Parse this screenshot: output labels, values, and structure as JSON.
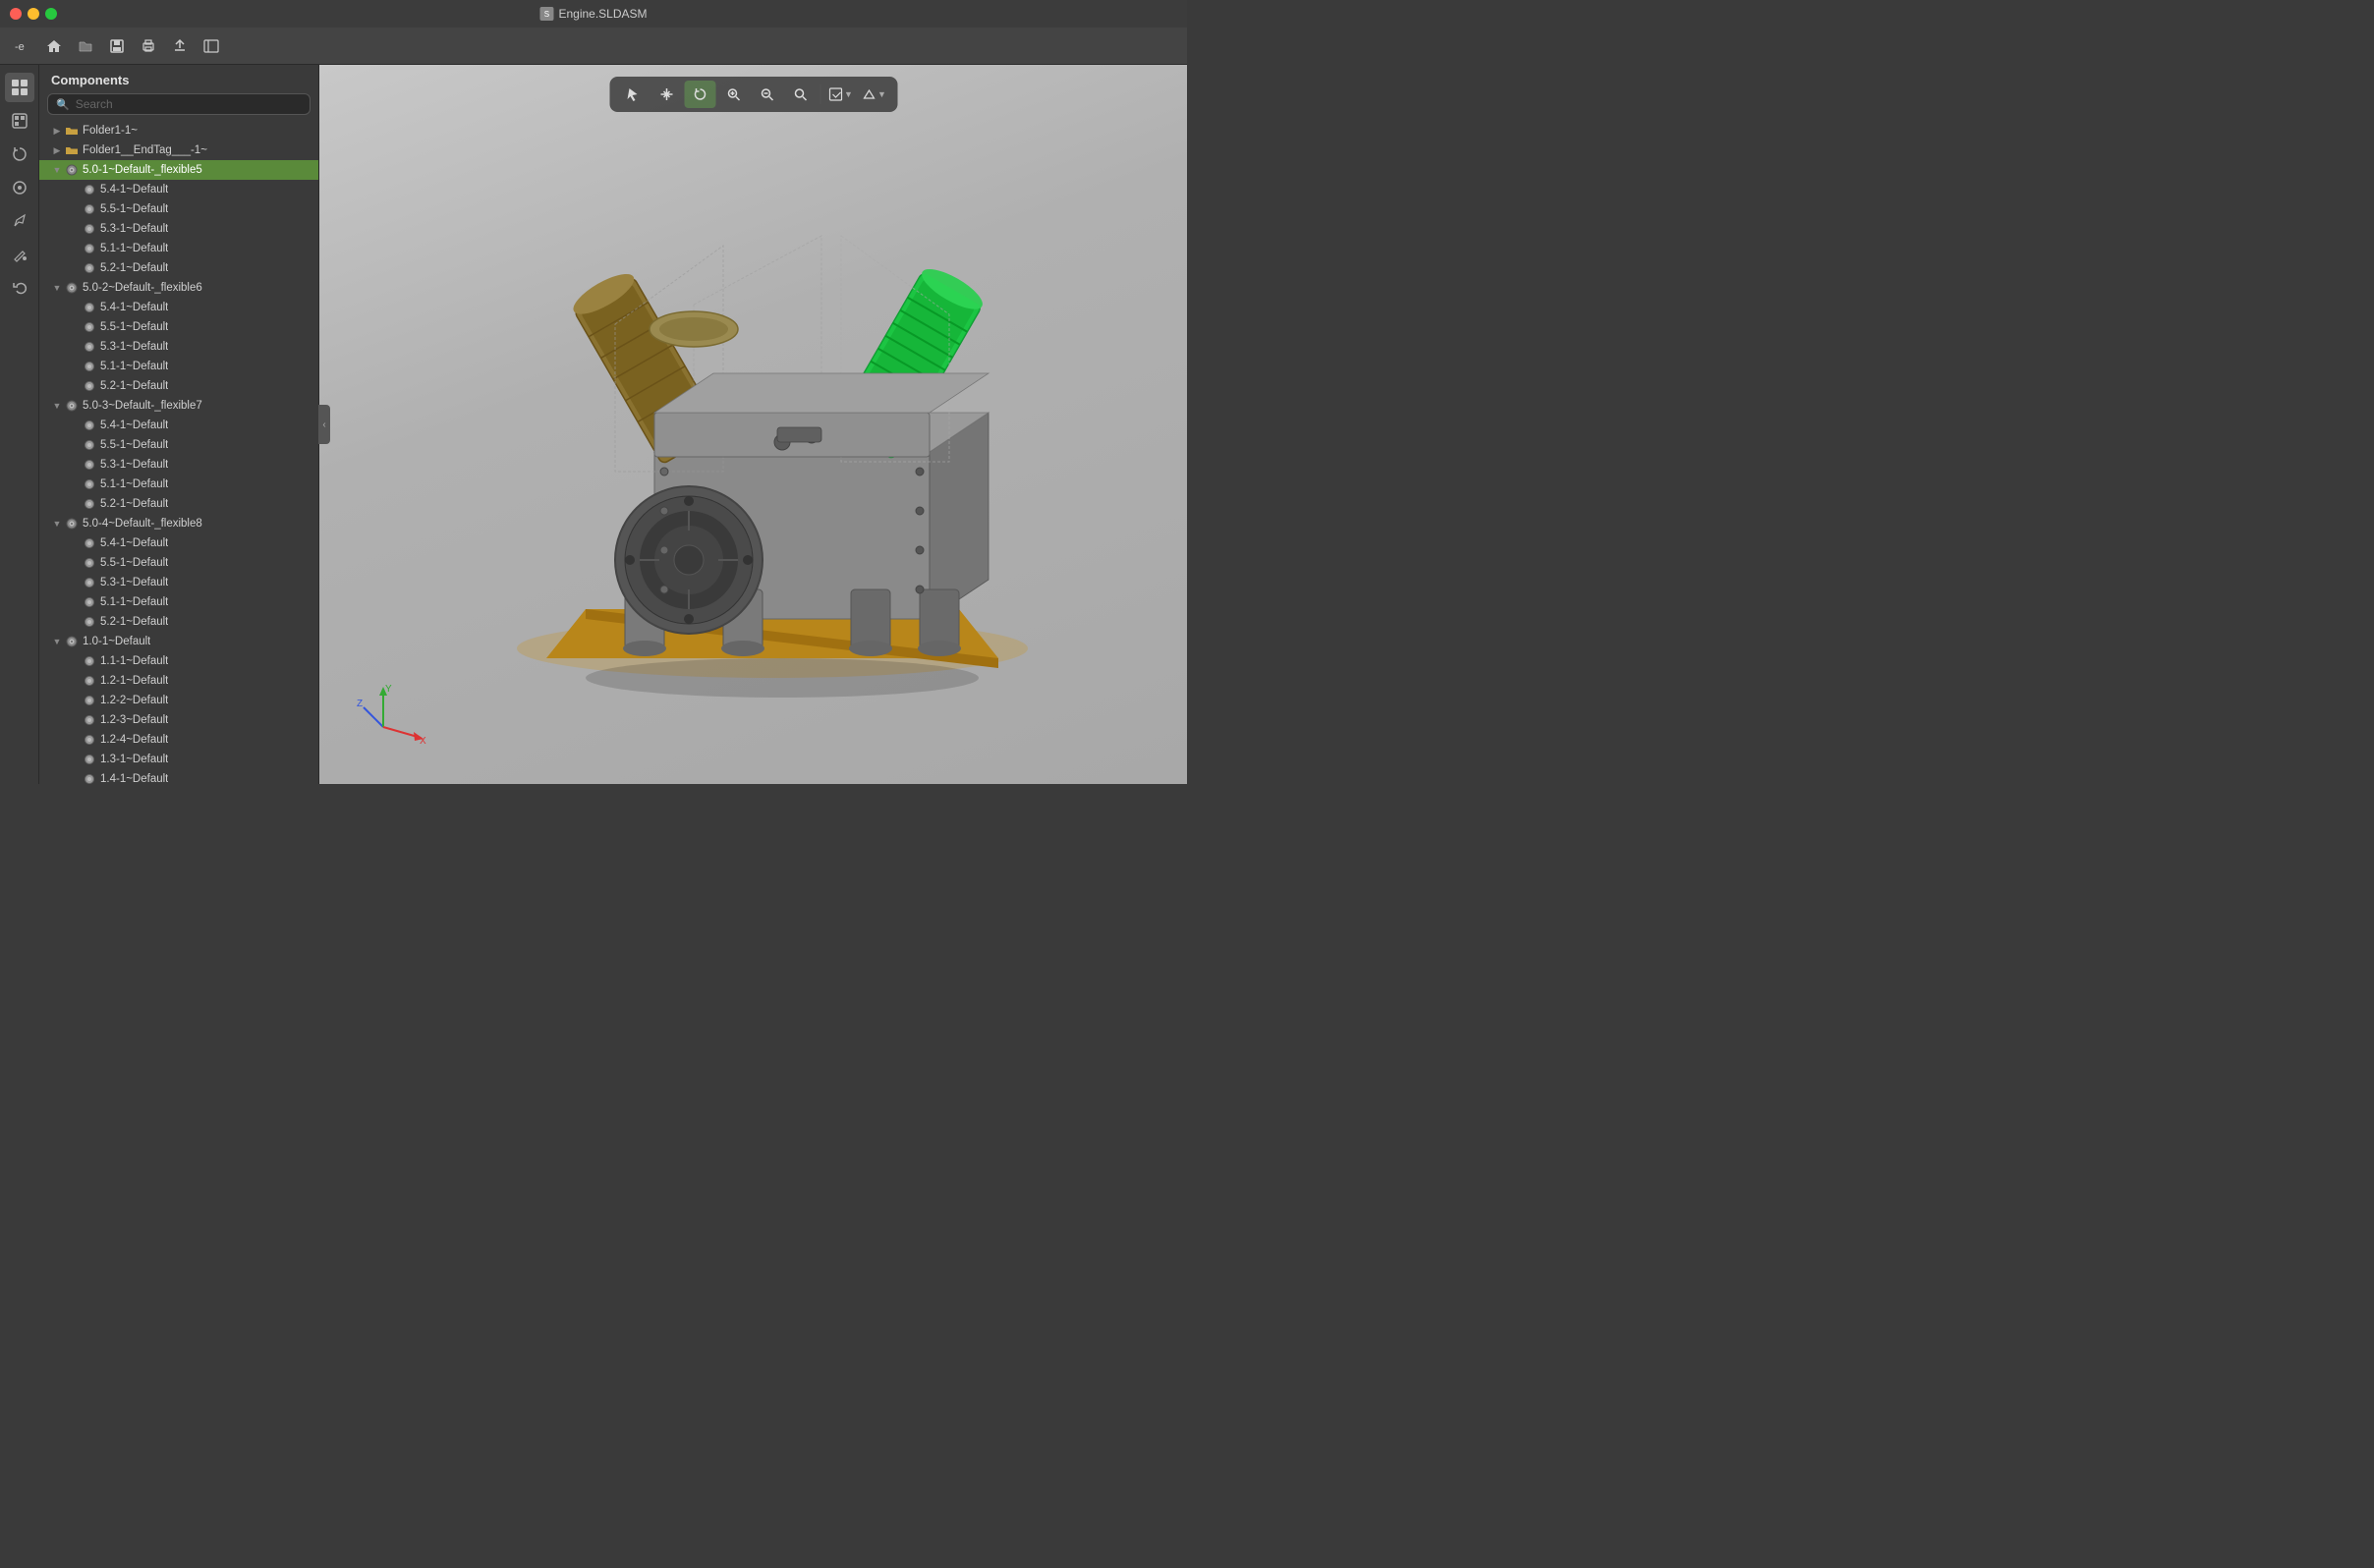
{
  "window": {
    "title": "Engine.SLDASM",
    "traffic_lights": [
      "close",
      "minimize",
      "maximize"
    ]
  },
  "toolbar": {
    "buttons": [
      {
        "name": "back",
        "icon": "←",
        "label": "-e"
      },
      {
        "name": "home",
        "icon": "⌂"
      },
      {
        "name": "open",
        "icon": "📁"
      },
      {
        "name": "save",
        "icon": "💾"
      },
      {
        "name": "print",
        "icon": "🖨"
      },
      {
        "name": "export",
        "icon": "↑"
      },
      {
        "name": "sidebar-toggle",
        "icon": "⊟"
      }
    ]
  },
  "sidebar": {
    "panel_title": "Components",
    "search_placeholder": "Search"
  },
  "tree": {
    "items": [
      {
        "id": "folder1",
        "label": "Folder1-1~",
        "level": 1,
        "type": "folder",
        "expanded": false
      },
      {
        "id": "folder1end",
        "label": "Folder1__EndTag___-1~",
        "level": 1,
        "type": "folder",
        "expanded": false
      },
      {
        "id": "5.0-1",
        "label": "5.0-1~Default-_flexible5",
        "level": 1,
        "type": "assembly",
        "expanded": true,
        "selected": true
      },
      {
        "id": "5.4-1a",
        "label": "5.4-1~Default",
        "level": 2,
        "type": "part"
      },
      {
        "id": "5.5-1a",
        "label": "5.5-1~Default",
        "level": 2,
        "type": "part"
      },
      {
        "id": "5.3-1a",
        "label": "5.3-1~Default",
        "level": 2,
        "type": "part"
      },
      {
        "id": "5.1-1a",
        "label": "5.1-1~Default",
        "level": 2,
        "type": "part"
      },
      {
        "id": "5.2-1a",
        "label": "5.2-1~Default",
        "level": 2,
        "type": "part"
      },
      {
        "id": "5.0-2",
        "label": "5.0-2~Default-_flexible6",
        "level": 1,
        "type": "assembly",
        "expanded": true
      },
      {
        "id": "5.4-1b",
        "label": "5.4-1~Default",
        "level": 2,
        "type": "part"
      },
      {
        "id": "5.5-1b",
        "label": "5.5-1~Default",
        "level": 2,
        "type": "part"
      },
      {
        "id": "5.3-1b",
        "label": "5.3-1~Default",
        "level": 2,
        "type": "part"
      },
      {
        "id": "5.1-1b",
        "label": "5.1-1~Default",
        "level": 2,
        "type": "part"
      },
      {
        "id": "5.2-1b",
        "label": "5.2-1~Default",
        "level": 2,
        "type": "part"
      },
      {
        "id": "5.0-3",
        "label": "5.0-3~Default-_flexible7",
        "level": 1,
        "type": "assembly",
        "expanded": true
      },
      {
        "id": "5.4-1c",
        "label": "5.4-1~Default",
        "level": 2,
        "type": "part"
      },
      {
        "id": "5.5-1c",
        "label": "5.5-1~Default",
        "level": 2,
        "type": "part"
      },
      {
        "id": "5.3-1c",
        "label": "5.3-1~Default",
        "level": 2,
        "type": "part"
      },
      {
        "id": "5.1-1c",
        "label": "5.1-1~Default",
        "level": 2,
        "type": "part"
      },
      {
        "id": "5.2-1c",
        "label": "5.2-1~Default",
        "level": 2,
        "type": "part"
      },
      {
        "id": "5.0-4",
        "label": "5.0-4~Default-_flexible8",
        "level": 1,
        "type": "assembly",
        "expanded": true
      },
      {
        "id": "5.4-1d",
        "label": "5.4-1~Default",
        "level": 2,
        "type": "part"
      },
      {
        "id": "5.5-1d",
        "label": "5.5-1~Default",
        "level": 2,
        "type": "part"
      },
      {
        "id": "5.3-1d",
        "label": "5.3-1~Default",
        "level": 2,
        "type": "part"
      },
      {
        "id": "5.1-1d",
        "label": "5.1-1~Default",
        "level": 2,
        "type": "part"
      },
      {
        "id": "5.2-1d",
        "label": "5.2-1~Default",
        "level": 2,
        "type": "part"
      },
      {
        "id": "1.0-1",
        "label": "1.0-1~Default",
        "level": 1,
        "type": "assembly",
        "expanded": true
      },
      {
        "id": "1.1-1",
        "label": "1.1-1~Default",
        "level": 2,
        "type": "part"
      },
      {
        "id": "1.2-1",
        "label": "1.2-1~Default",
        "level": 2,
        "type": "part"
      },
      {
        "id": "1.2-2",
        "label": "1.2-2~Default",
        "level": 2,
        "type": "part"
      },
      {
        "id": "1.2-3",
        "label": "1.2-3~Default",
        "level": 2,
        "type": "part"
      },
      {
        "id": "1.2-4",
        "label": "1.2-4~Default",
        "level": 2,
        "type": "part"
      },
      {
        "id": "1.3-1",
        "label": "1.3-1~Default",
        "level": 2,
        "type": "part"
      },
      {
        "id": "1.4-1",
        "label": "1.4-1~Default",
        "level": 2,
        "type": "part"
      }
    ]
  },
  "viewport_toolbar": {
    "buttons": [
      {
        "name": "select",
        "icon": "↖",
        "active": false
      },
      {
        "name": "pan",
        "icon": "✥",
        "active": false
      },
      {
        "name": "rotate",
        "icon": "↻",
        "active": false
      },
      {
        "name": "zoom-in-area",
        "icon": "⊕",
        "active": false
      },
      {
        "name": "zoom-out",
        "icon": "⊖",
        "active": false
      },
      {
        "name": "zoom-fit",
        "icon": "⊙",
        "active": false
      },
      {
        "name": "display-style",
        "icon": "◻",
        "has_arrow": true
      },
      {
        "name": "view-orientation",
        "icon": "◼",
        "has_arrow": true
      }
    ]
  },
  "axes": {
    "x_color": "#dd3333",
    "y_color": "#33aa33",
    "z_color": "#3333dd",
    "x_label": "X",
    "y_label": "Y",
    "z_label": "Z"
  },
  "colors": {
    "selected_bg": "#5a8a3a",
    "toolbar_bg": "#444444",
    "panel_bg": "#3a3a3a",
    "viewport_bg_start": "#c8c8c8",
    "viewport_bg_end": "#a8a8a8"
  }
}
